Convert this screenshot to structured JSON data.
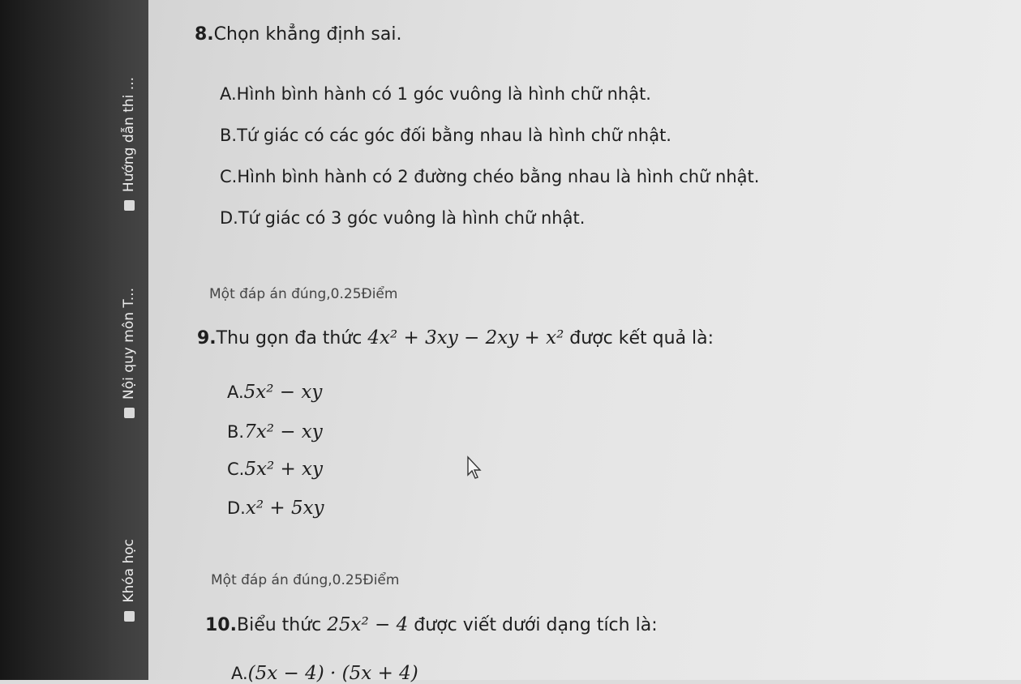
{
  "sidebar": {
    "tabs": [
      {
        "label": "Hướng dẫn thi ..."
      },
      {
        "label": "Nội quy môn T..."
      },
      {
        "label": "Khóa học"
      }
    ]
  },
  "questions": [
    {
      "number": "8.",
      "title": "Chọn khẳng định sai.",
      "options": [
        "A.Hình bình hành có 1 góc vuông là hình chữ nhật.",
        "B.Tứ giác có các góc đối bằng nhau là hình chữ nhật.",
        "C.Hình bình hành có 2 đường chéo bằng nhau là hình chữ nhật.",
        "D.Tứ giác có 3 góc vuông là hình chữ nhật."
      ],
      "points": "Một đáp án đúng,0.25Điểm"
    },
    {
      "number": "9.",
      "title_prefix": "Thu gọn đa thức ",
      "expr": "4x² + 3xy − 2xy + x²",
      "title_suffix": " được kết quả là:",
      "options": [
        {
          "prefix": "A.",
          "expr": "5x² − xy"
        },
        {
          "prefix": "B.",
          "expr": "7x² − xy"
        },
        {
          "prefix": "C.",
          "expr": "5x² + xy"
        },
        {
          "prefix": "D.",
          "expr": "x² + 5xy"
        }
      ],
      "points": "Một đáp án đúng,0.25Điểm"
    },
    {
      "number": "10.",
      "title_prefix": "Biểu thức ",
      "expr": "25x² − 4",
      "title_suffix": " được viết dưới dạng tích là:",
      "options": [
        {
          "prefix": "A.",
          "expr": "(5x − 4) · (5x + 4)"
        }
      ]
    }
  ],
  "icons": {
    "cursor": "arrow-cursor-icon",
    "tab": "tab-icon"
  }
}
